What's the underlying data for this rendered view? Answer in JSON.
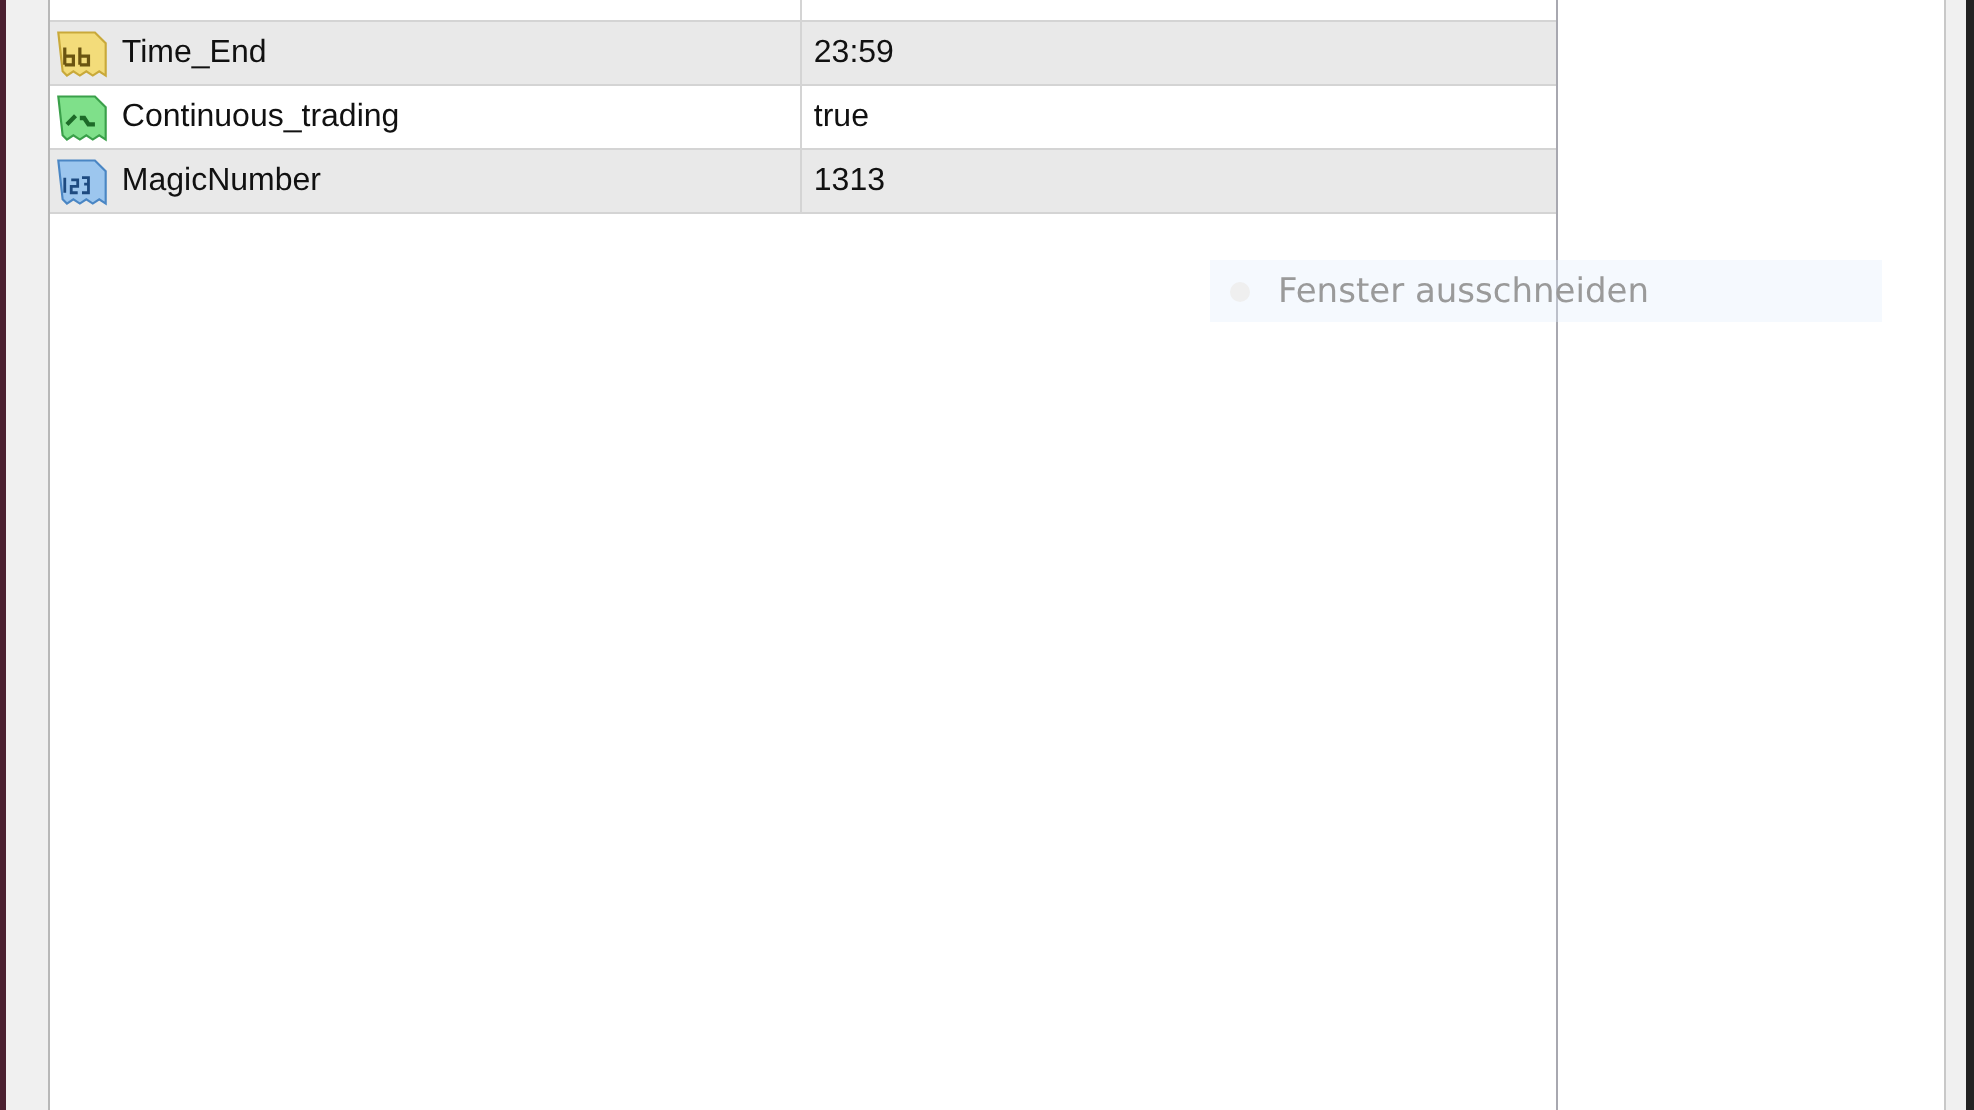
{
  "parameters": [
    {
      "kind": "string",
      "name": "Time_End",
      "value": "23:59"
    },
    {
      "kind": "bool",
      "name": "Continuous_trading",
      "value": "true"
    },
    {
      "kind": "int",
      "name": "MagicNumber",
      "value": "1313"
    }
  ],
  "ghost_tooltip": {
    "label": "Fenster ausschneiden"
  }
}
